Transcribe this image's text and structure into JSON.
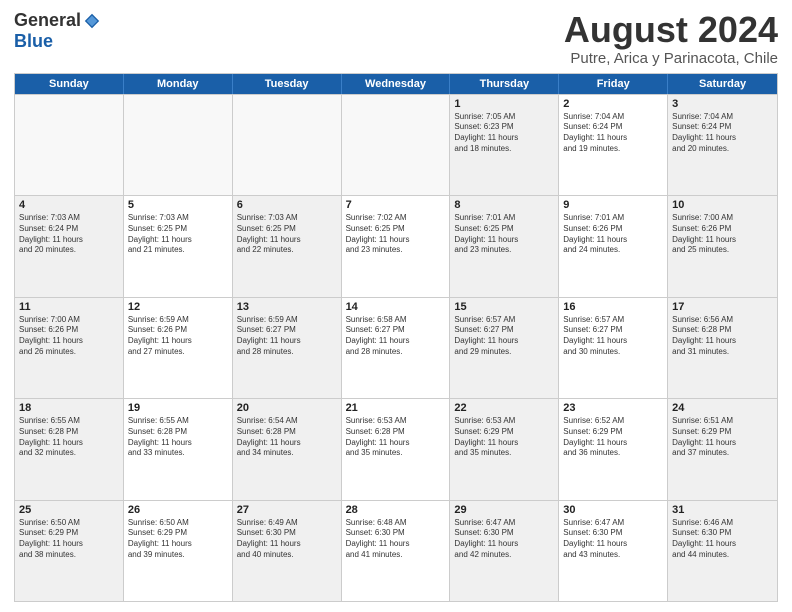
{
  "logo": {
    "general": "General",
    "blue": "Blue"
  },
  "title": "August 2024",
  "location": "Putre, Arica y Parinacota, Chile",
  "days_header": [
    "Sunday",
    "Monday",
    "Tuesday",
    "Wednesday",
    "Thursday",
    "Friday",
    "Saturday"
  ],
  "weeks": [
    [
      {
        "day": "",
        "info": ""
      },
      {
        "day": "",
        "info": ""
      },
      {
        "day": "",
        "info": ""
      },
      {
        "day": "",
        "info": ""
      },
      {
        "day": "1",
        "info": "Sunrise: 7:05 AM\nSunset: 6:23 PM\nDaylight: 11 hours\nand 18 minutes."
      },
      {
        "day": "2",
        "info": "Sunrise: 7:04 AM\nSunset: 6:24 PM\nDaylight: 11 hours\nand 19 minutes."
      },
      {
        "day": "3",
        "info": "Sunrise: 7:04 AM\nSunset: 6:24 PM\nDaylight: 11 hours\nand 20 minutes."
      }
    ],
    [
      {
        "day": "4",
        "info": "Sunrise: 7:03 AM\nSunset: 6:24 PM\nDaylight: 11 hours\nand 20 minutes."
      },
      {
        "day": "5",
        "info": "Sunrise: 7:03 AM\nSunset: 6:25 PM\nDaylight: 11 hours\nand 21 minutes."
      },
      {
        "day": "6",
        "info": "Sunrise: 7:03 AM\nSunset: 6:25 PM\nDaylight: 11 hours\nand 22 minutes."
      },
      {
        "day": "7",
        "info": "Sunrise: 7:02 AM\nSunset: 6:25 PM\nDaylight: 11 hours\nand 23 minutes."
      },
      {
        "day": "8",
        "info": "Sunrise: 7:01 AM\nSunset: 6:25 PM\nDaylight: 11 hours\nand 23 minutes."
      },
      {
        "day": "9",
        "info": "Sunrise: 7:01 AM\nSunset: 6:26 PM\nDaylight: 11 hours\nand 24 minutes."
      },
      {
        "day": "10",
        "info": "Sunrise: 7:00 AM\nSunset: 6:26 PM\nDaylight: 11 hours\nand 25 minutes."
      }
    ],
    [
      {
        "day": "11",
        "info": "Sunrise: 7:00 AM\nSunset: 6:26 PM\nDaylight: 11 hours\nand 26 minutes."
      },
      {
        "day": "12",
        "info": "Sunrise: 6:59 AM\nSunset: 6:26 PM\nDaylight: 11 hours\nand 27 minutes."
      },
      {
        "day": "13",
        "info": "Sunrise: 6:59 AM\nSunset: 6:27 PM\nDaylight: 11 hours\nand 28 minutes."
      },
      {
        "day": "14",
        "info": "Sunrise: 6:58 AM\nSunset: 6:27 PM\nDaylight: 11 hours\nand 28 minutes."
      },
      {
        "day": "15",
        "info": "Sunrise: 6:57 AM\nSunset: 6:27 PM\nDaylight: 11 hours\nand 29 minutes."
      },
      {
        "day": "16",
        "info": "Sunrise: 6:57 AM\nSunset: 6:27 PM\nDaylight: 11 hours\nand 30 minutes."
      },
      {
        "day": "17",
        "info": "Sunrise: 6:56 AM\nSunset: 6:28 PM\nDaylight: 11 hours\nand 31 minutes."
      }
    ],
    [
      {
        "day": "18",
        "info": "Sunrise: 6:55 AM\nSunset: 6:28 PM\nDaylight: 11 hours\nand 32 minutes."
      },
      {
        "day": "19",
        "info": "Sunrise: 6:55 AM\nSunset: 6:28 PM\nDaylight: 11 hours\nand 33 minutes."
      },
      {
        "day": "20",
        "info": "Sunrise: 6:54 AM\nSunset: 6:28 PM\nDaylight: 11 hours\nand 34 minutes."
      },
      {
        "day": "21",
        "info": "Sunrise: 6:53 AM\nSunset: 6:28 PM\nDaylight: 11 hours\nand 35 minutes."
      },
      {
        "day": "22",
        "info": "Sunrise: 6:53 AM\nSunset: 6:29 PM\nDaylight: 11 hours\nand 35 minutes."
      },
      {
        "day": "23",
        "info": "Sunrise: 6:52 AM\nSunset: 6:29 PM\nDaylight: 11 hours\nand 36 minutes."
      },
      {
        "day": "24",
        "info": "Sunrise: 6:51 AM\nSunset: 6:29 PM\nDaylight: 11 hours\nand 37 minutes."
      }
    ],
    [
      {
        "day": "25",
        "info": "Sunrise: 6:50 AM\nSunset: 6:29 PM\nDaylight: 11 hours\nand 38 minutes."
      },
      {
        "day": "26",
        "info": "Sunrise: 6:50 AM\nSunset: 6:29 PM\nDaylight: 11 hours\nand 39 minutes."
      },
      {
        "day": "27",
        "info": "Sunrise: 6:49 AM\nSunset: 6:30 PM\nDaylight: 11 hours\nand 40 minutes."
      },
      {
        "day": "28",
        "info": "Sunrise: 6:48 AM\nSunset: 6:30 PM\nDaylight: 11 hours\nand 41 minutes."
      },
      {
        "day": "29",
        "info": "Sunrise: 6:47 AM\nSunset: 6:30 PM\nDaylight: 11 hours\nand 42 minutes."
      },
      {
        "day": "30",
        "info": "Sunrise: 6:47 AM\nSunset: 6:30 PM\nDaylight: 11 hours\nand 43 minutes."
      },
      {
        "day": "31",
        "info": "Sunrise: 6:46 AM\nSunset: 6:30 PM\nDaylight: 11 hours\nand 44 minutes."
      }
    ]
  ]
}
